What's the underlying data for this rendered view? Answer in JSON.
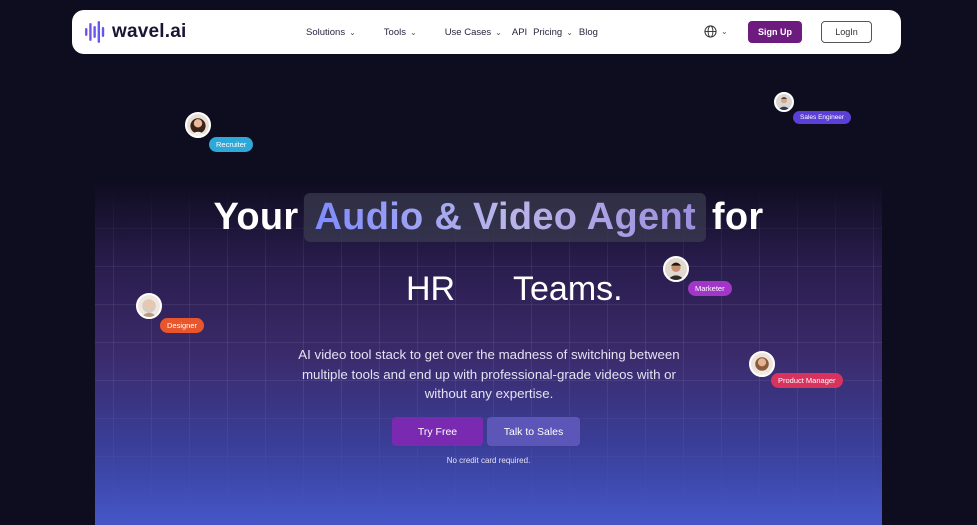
{
  "brand": {
    "name": "wavel.ai",
    "icon": "waveform-logo-icon",
    "logo_colors": [
      "#4b6bff",
      "#8b3fd9"
    ]
  },
  "nav": {
    "items": [
      {
        "label": "Solutions",
        "has_caret": true
      },
      {
        "label": "Tools",
        "has_caret": true
      },
      {
        "label": "Use Cases",
        "has_caret": true
      },
      {
        "label": "API",
        "has_caret": false
      },
      {
        "label": "Pricing",
        "has_caret": true
      },
      {
        "label": "Blog",
        "has_caret": false
      }
    ],
    "caret_glyph": "⌄",
    "language_icon": "globe-icon",
    "signup_label": "Sign Up",
    "login_label": "LogIn"
  },
  "hero": {
    "prefix": "Your",
    "highlight": "Audio & Video Agent",
    "suffix": "for",
    "line2_word": "HR",
    "line2_end": "Teams.",
    "subtitle": "AI video tool stack to get over the madness of switching between multiple tools and end up with professional-grade videos with or without any expertise.",
    "try_label": "Try Free",
    "talk_label": "Talk to Sales",
    "note": "No credit card required."
  },
  "personas": [
    {
      "label": "Recruiter",
      "color": "#2ea8d8",
      "icon": "recruiter-avatar-icon"
    },
    {
      "label": "Sales Engineer",
      "color": "#5b3fd6",
      "icon": "sales-engineer-avatar-icon"
    },
    {
      "label": "Marketer",
      "color": "#a236c8",
      "icon": "marketer-avatar-icon"
    },
    {
      "label": "Designer",
      "color": "#e8562e",
      "icon": "designer-avatar-icon"
    },
    {
      "label": "Product Manager",
      "color": "#d8335e",
      "icon": "product-manager-avatar-icon"
    }
  ],
  "colors": {
    "background": "#0e0c1f",
    "signup": "#6d1b7f",
    "try_free": "#7a2ab0",
    "talk_sales": "#5c56b8"
  }
}
